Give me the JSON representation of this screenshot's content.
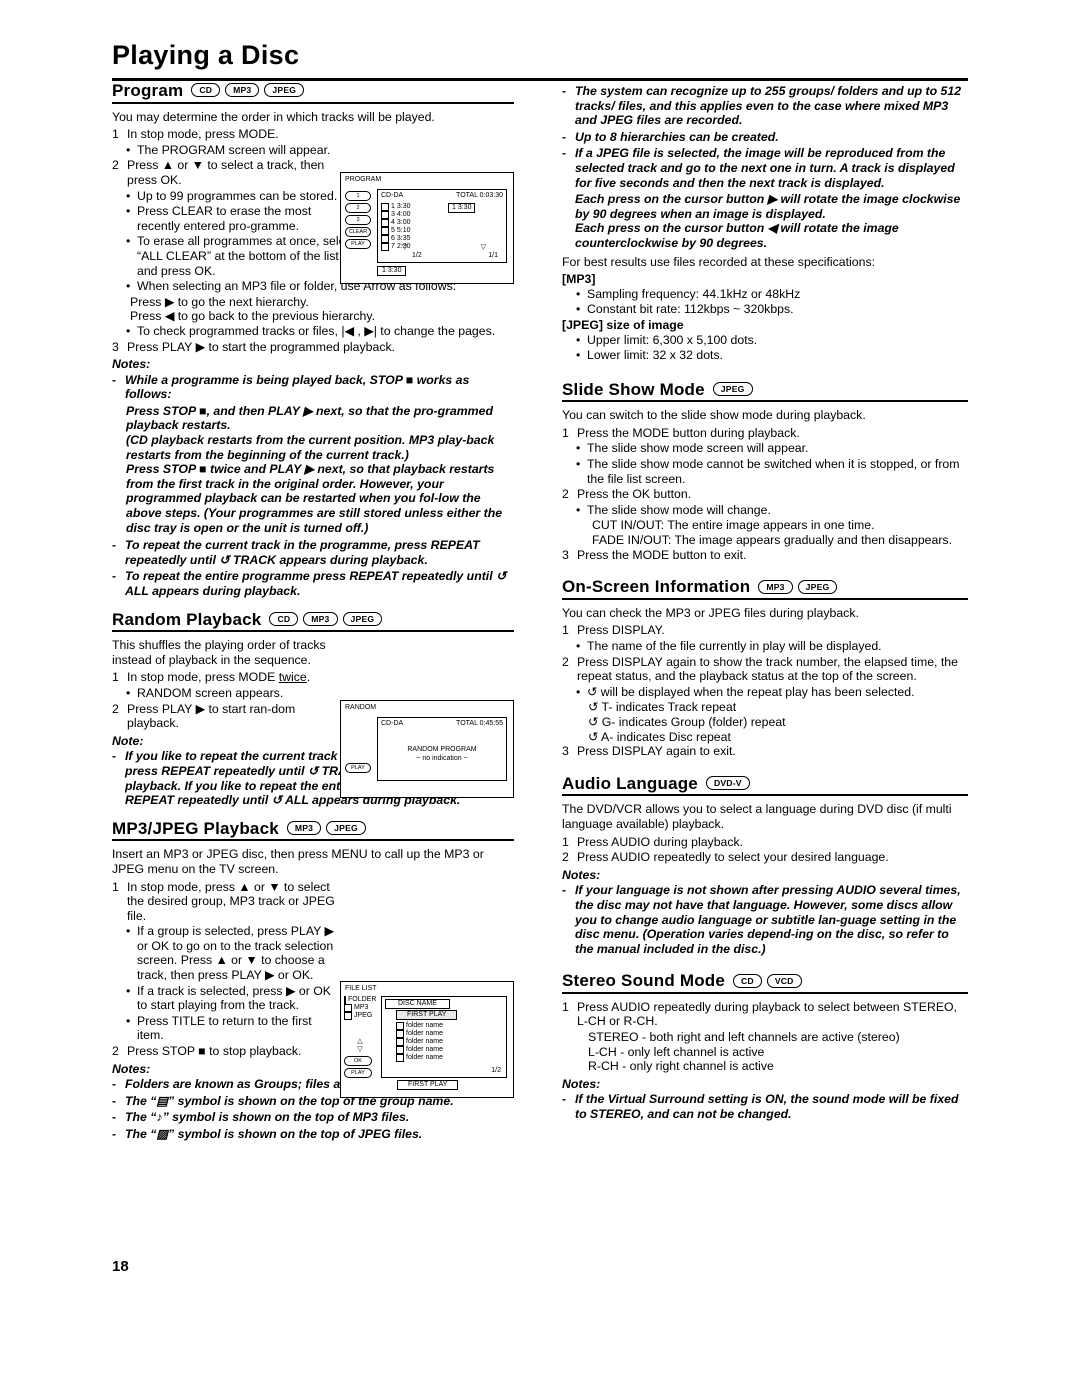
{
  "page": {
    "title": "Playing a Disc",
    "number": "18"
  },
  "badges": {
    "cd": "CD",
    "mp3": "MP3",
    "jpeg": "JPEG",
    "dvdv": "DVD-V",
    "vcd": "VCD"
  },
  "program": {
    "heading": "Program",
    "intro": "You may determine the order in which tracks will be played.",
    "step1": {
      "n": "1",
      "t": "In stop mode, press MODE."
    },
    "step1_b1": "The PROGRAM screen will appear.",
    "step2": {
      "n": "2",
      "t": "Press ▲ or ▼ to select a track, then press OK."
    },
    "step2_b1": "Up to 99 programmes can be stored.",
    "step2_b2": "Press CLEAR to erase the most recently entered pro-gramme.",
    "step2_b3": "To erase all programmes at once, select “ALL CLEAR” at the bottom of the list and press OK.",
    "step2_b4": "When selecting an MP3 file or folder, use Arrow as follows:",
    "step2_b4a": "Press ▶ to go the next hierarchy.",
    "step2_b4b": "Press ◀ to go back to the previous hierarchy.",
    "step2_b5": "To check programmed tracks or files, |◀ , ▶| to change the pages.",
    "step3": {
      "n": "3",
      "t": "Press PLAY ▶ to start the programmed playback."
    },
    "notes_label": "Notes:",
    "note1": "While a programme is being played back, STOP ■ works as follows:",
    "note1a": "Press STOP ■, and then PLAY ▶ next, so that the pro-grammed playback restarts.",
    "note1b": "(CD playback restarts from the current position. MP3 play-back restarts from the beginning of the current track.)",
    "note1c": "Press STOP ■ twice and PLAY ▶ next, so that playback restarts from the first track in the original order. However, your programmed playback can be restarted when you fol-low the above steps. (Your programmes are still stored unless either the disc tray is open or the unit is turned off.)",
    "note2": "To repeat the current track in the programme, press REPEAT repeatedly until ↺ TRACK appears during playback.",
    "note3": "To repeat the entire programme press REPEAT repeatedly until ↺ ALL appears during playback.",
    "screen": {
      "title": "PROGRAM",
      "disc": "CD-DA",
      "total_label": "TOTAL 0:03:30",
      "track_indicator": "1   3:30",
      "rows": [
        {
          "n": "1",
          "t": "3:30"
        },
        {
          "n": "3",
          "t": "4:00"
        },
        {
          "n": "4",
          "t": "3:00"
        },
        {
          "n": "5",
          "t": "5:10"
        },
        {
          "n": "6",
          "t": "3:35"
        },
        {
          "n": "7",
          "t": "2:30"
        }
      ],
      "page": "1/2",
      "page2": "1/1",
      "bottom": "1   3:30",
      "clear_btn": "CLEAR",
      "side_btns": [
        "1",
        "2",
        "3",
        "CLEAR",
        "PLAY"
      ]
    }
  },
  "random": {
    "heading": "Random Playback",
    "intro": "This shuffles the playing order of tracks instead of playback in the sequence.",
    "step1": {
      "n": "1",
      "t": "In stop mode, press MODE twice."
    },
    "step1_b1": "RANDOM screen appears.",
    "step2": {
      "n": "2",
      "t": "Press PLAY ▶ to start ran-dom playback."
    },
    "note_label": "Note:",
    "note1": "If you like to repeat the current track in the random selection, press REPEAT repeatedly until ↺ TRACK appears during playback. If you like to repeat the entire random selection press REPEAT repeatedly until ↺ ALL appears during playback.",
    "screen": {
      "title": "RANDOM",
      "disc": "CD-DA",
      "total_label": "TOTAL 0:45:55",
      "center1": "RANDOM PROGRAM",
      "center2": "~ no indication ~",
      "play_btn": "PLAY"
    }
  },
  "mp3jpeg": {
    "heading": "MP3/JPEG Playback",
    "intro": "Insert an MP3 or JPEG disc, then press MENU to call up the MP3 or JPEG menu on the TV screen.",
    "step1": {
      "n": "1",
      "t": "In stop mode, press ▲ or ▼ to select the desired group, MP3 track or JPEG file."
    },
    "step1_b1": "If a group is selected, press PLAY ▶ or OK to go on to the track selection screen. Press ▲ or ▼ to choose a track, then press PLAY ▶ or OK.",
    "step1_b2": "If a track is selected, press ▶ or OK to start playing from the track.",
    "step1_b3": "Press TITLE to return to the first item.",
    "step2": {
      "n": "2",
      "t": "Press STOP ■ to stop playback."
    },
    "notes_label": "Notes:",
    "note1": "Folders are known as Groups; files are known as Tracks.",
    "note2": "The “▤” symbol is shown on the top of the group name.",
    "note3": "The “♪” symbol is shown on the top of MP3 files.",
    "note4": "The “▨” symbol is shown on the top of JPEG files.",
    "screen": {
      "title": "FILE LIST",
      "legend": [
        "FOLDER",
        "MP3",
        "JPEG"
      ],
      "col_header": "DISC NAME",
      "first_play": "FIRST PLAY",
      "rows": [
        "folder name",
        "folder name",
        "folder name",
        "folder name",
        "folder name"
      ],
      "page": "1/2",
      "bottom": "FIRST PLAY",
      "side_btns": [
        "OK",
        "PLAY"
      ]
    }
  },
  "right_top": {
    "d1": "The system can recognize up to 255 groups/ folders and up to 512 tracks/ files, and this applies even to the case where mixed MP3 and JPEG files are recorded.",
    "d2": "Up to 8 hierarchies can be created.",
    "d3": "If a JPEG file is selected, the image will be reproduced from the selected track and go to the next one in turn. A track is displayed for five seconds and then the next track is displayed.",
    "d4": "Each press on the cursor button ▶ will rotate the image clockwise by 90 degrees when an image is displayed.",
    "d5": "Each press on the cursor button ◀ will rotate the image counterclockwise by 90 degrees.",
    "spec_intro": "For best results use files recorded at these specifications:",
    "mp3_label": "[MP3]",
    "mp3_b1": "Sampling frequency: 44.1kHz or 48kHz",
    "mp3_b2": "Constant bit rate: 112kbps ~ 320kbps.",
    "jpeg_label": "[JPEG] size of image",
    "jpeg_b1": "Upper limit: 6,300 x 5,100 dots.",
    "jpeg_b2": "Lower limit: 32 x 32 dots."
  },
  "slideshow": {
    "heading": "Slide Show Mode",
    "intro": "You can switch to the slide show mode during playback.",
    "step1": {
      "n": "1",
      "t": "Press the MODE button during playback."
    },
    "step1_b1": "The slide show mode screen will appear.",
    "step1_b2": "The slide show mode cannot be switched when it is stopped, or from the file list screen.",
    "step2": {
      "n": "2",
      "t": "Press the OK button."
    },
    "step2_b1": "The slide show mode will change.",
    "step2_t1": "CUT IN/OUT: The entire image appears in one time.",
    "step2_t2": "FADE IN/OUT: The image appears gradually and then disappears.",
    "step3": {
      "n": "3",
      "t": "Press the MODE button to exit."
    }
  },
  "onscreen": {
    "heading": "On-Screen Information",
    "intro": "You can check the MP3 or JPEG files during playback.",
    "step1": {
      "n": "1",
      "t": "Press DISPLAY."
    },
    "step1_b1": "The name of the file currently in play will be displayed.",
    "step2": {
      "n": "2",
      "t": "Press DISPLAY again to show the track number, the elapsed time, the repeat status, and the playback status at the top of the screen."
    },
    "step2_b1": "↺ will be displayed when the repeat play has been selected.",
    "step2_t1": "↺ T- indicates Track repeat",
    "step2_t2": "↺ G- indicates Group (folder) repeat",
    "step2_t3": "↺ A- indicates Disc repeat",
    "step3": {
      "n": "3",
      "t": "Press DISPLAY again to exit."
    }
  },
  "audio_language": {
    "heading": "Audio Language",
    "intro": "The DVD/VCR allows you to select a language during DVD disc (if multi language available) playback.",
    "step1": {
      "n": "1",
      "t": "Press AUDIO during playback."
    },
    "step2": {
      "n": "2",
      "t": "Press AUDIO repeatedly to select your desired language."
    },
    "notes_label": "Notes:",
    "note1": "If your language is not shown after pressing AUDIO several times, the disc may not have that language. However, some discs allow you to change audio language or subtitle lan-guage setting in the disc menu. (Operation varies depend-ing on the disc, so refer to the manual included in the disc.)"
  },
  "stereo": {
    "heading": "Stereo Sound Mode",
    "step1": {
      "n": "1",
      "t": "Press AUDIO repeatedly during playback to select between STEREO, L-CH or R-CH."
    },
    "t1": "STEREO - both right and left channels are active (stereo)",
    "t2": "L-CH - only left channel is active",
    "t3": "R-CH - only right channel is active",
    "notes_label": "Notes:",
    "note1": "If the Virtual Surround setting is ON, the sound mode will be fixed to STEREO, and can not be changed."
  }
}
